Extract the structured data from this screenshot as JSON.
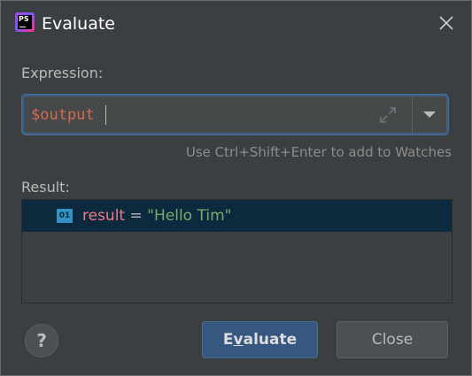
{
  "window": {
    "title": "Evaluate",
    "app_icon": "phpstorm-icon",
    "app_icon_text": "PS"
  },
  "expression": {
    "label": "Expression:",
    "value": "$output",
    "hint": "Use Ctrl+Shift+Enter to add to Watches",
    "expand_icon": "expand-icon",
    "dropdown_icon": "chevron-down-icon"
  },
  "result": {
    "label": "Result:",
    "rows": [
      {
        "type_badge": "01",
        "name": "result",
        "operator": "=",
        "value": "\"Hello Tim\""
      }
    ]
  },
  "buttons": {
    "help": "?",
    "evaluate_mnemonic": "v",
    "evaluate_prefix": "E",
    "evaluate_suffix": "aluate",
    "close": "Close"
  },
  "colors": {
    "background": "#3c3f41",
    "accent": "#365880",
    "selection": "#0d293e",
    "variable": "#f07b86",
    "string": "#7fa86a",
    "expression_text": "#d36a4e"
  }
}
